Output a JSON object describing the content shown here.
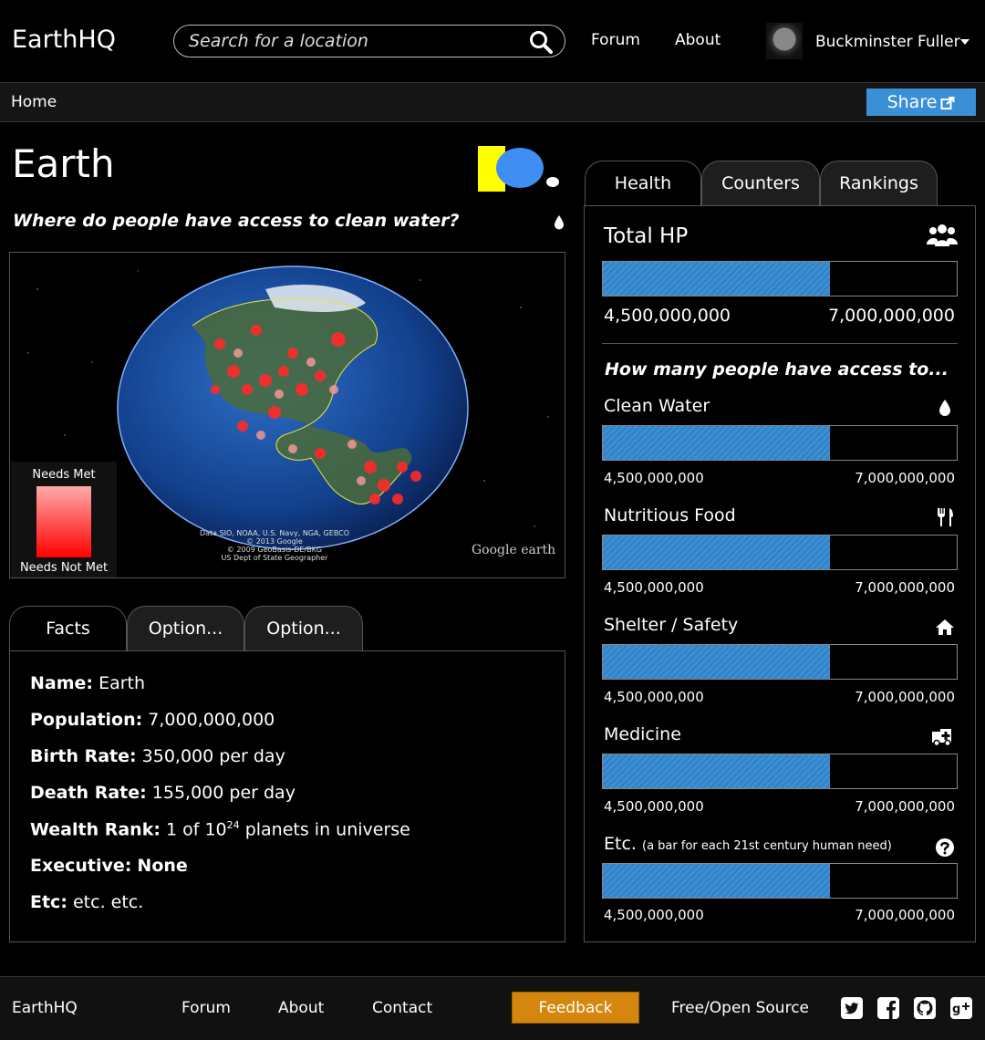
{
  "header": {
    "logo": "EarthHQ",
    "search_placeholder": "Search for a location",
    "nav": [
      "Forum",
      "About"
    ],
    "user_name": "Buckminster Fuller"
  },
  "breadcrumb": {
    "home": "Home",
    "share_label": "Share"
  },
  "location": {
    "title": "Earth",
    "question": "Where do people have access to clean water?",
    "map": {
      "legend_top": "Needs Met",
      "legend_bottom": "Needs Not Met",
      "credit": [
        "Data SIO, NOAA, U.S. Navy, NGA, GEBCO",
        "© 2013 Google",
        "© 2009 GeoBasis-DE/BKG",
        "US Dept of State Geographer"
      ],
      "brand": "Google earth"
    }
  },
  "facts_tabs": [
    "Facts",
    "Option...",
    "Option..."
  ],
  "facts": [
    {
      "label": "Name:",
      "value": "Earth"
    },
    {
      "label": "Population:",
      "value": "7,000,000,000"
    },
    {
      "label": "Birth Rate:",
      "value": "350,000 per day"
    },
    {
      "label": "Death Rate:",
      "value": "155,000 per day"
    },
    {
      "label": "Wealth Rank:",
      "value_pre": "1 of 10",
      "value_sup": "24",
      "value_post": " planets in universe"
    },
    {
      "label": "Executive:",
      "value": "None",
      "bold_value": true
    },
    {
      "label": "Etc:",
      "value": "etc. etc."
    }
  ],
  "right_tabs": [
    "Health",
    "Counters",
    "Rankings"
  ],
  "health": {
    "total_title": "Total HP",
    "total_min": "4,500,000,000",
    "total_max": "7,000,000,000",
    "total_fraction": 0.643,
    "access_question": "How many people have access to...",
    "needs": [
      {
        "label": "Clean Water",
        "icon": "water-drop-icon",
        "min": "4,500,000,000",
        "max": "7,000,000,000",
        "fraction": 0.643
      },
      {
        "label": "Nutritious Food",
        "icon": "fork-knife-icon",
        "min": "4,500,000,000",
        "max": "7,000,000,000",
        "fraction": 0.643
      },
      {
        "label": "Shelter / Safety",
        "icon": "home-icon",
        "min": "4,500,000,000",
        "max": "7,000,000,000",
        "fraction": 0.643
      },
      {
        "label": "Medicine",
        "icon": "ambulance-icon",
        "min": "4,500,000,000",
        "max": "7,000,000,000",
        "fraction": 0.643
      },
      {
        "label": "Etc.",
        "sub": "(a bar for each 21st century human need)",
        "icon": "question-icon",
        "min": "4,500,000,000",
        "max": "7,000,000,000",
        "fraction": 0.643
      }
    ]
  },
  "footer": {
    "logo": "EarthHQ",
    "links": [
      "Forum",
      "About",
      "Contact"
    ],
    "feedback": "Feedback",
    "open_source": "Free/Open Source",
    "social": [
      "twitter-icon",
      "facebook-icon",
      "github-icon",
      "google-plus-icon"
    ]
  },
  "colors": {
    "accent_blue": "#3a8fd6",
    "feedback_orange": "#d4860f",
    "heat_red": "#ff0000",
    "flag_yellow": "#ffff00"
  }
}
